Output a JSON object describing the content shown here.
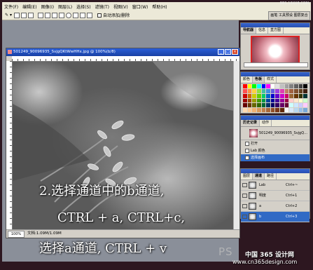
{
  "app": {
    "menu": [
      "文件(F)",
      "编辑(E)",
      "图像(I)",
      "图层(L)",
      "选择(S)",
      "滤镜(T)",
      "视图(V)",
      "窗口(W)",
      "帮助(H)"
    ],
    "brand": "BBS.16XX8.COM"
  },
  "options": {
    "auto_add_delete": "自动添加/删除",
    "palette_well": "画笔 工具预设 图层复合"
  },
  "document": {
    "title": "501249_90096935_SvjgQKtWwHHx.jpg @ 100%(b/8)",
    "zoom": "100%",
    "info": "文档:1.09M/1.09M"
  },
  "caption": {
    "line1": "2.选择通道中的b通道,",
    "line2": "CTRL + a, CTRL+c,",
    "line3": "选择a通道, CTRL + v"
  },
  "panels": {
    "navigator_tabs": [
      "导航器",
      "信息",
      "直方图"
    ],
    "color_tabs": [
      "颜色",
      "色板",
      "样式"
    ],
    "history_tabs": [
      "历史记录",
      "动作"
    ],
    "history_snapshot": "501249_90096935_SvjgQ...",
    "history_items": [
      "打开",
      "Lab 颜色",
      "选择画布"
    ],
    "channels_tabs": [
      "图层",
      "通道",
      "路径"
    ],
    "channels": [
      {
        "name": "Lab",
        "key": "Ctrl+~"
      },
      {
        "name": "明度",
        "key": "Ctrl+1"
      },
      {
        "name": "a",
        "key": "Ctrl+2"
      },
      {
        "name": "b",
        "key": "Ctrl+3"
      }
    ]
  },
  "swatch_colors": [
    "#ff0000",
    "#ffff00",
    "#00ff00",
    "#00ffff",
    "#0000ff",
    "#ff00ff",
    "#ffffff",
    "#e0e0e0",
    "#c0c0c0",
    "#a0a0a0",
    "#808080",
    "#606060",
    "#404040",
    "#000000",
    "#ff5050",
    "#ff9040",
    "#ffd040",
    "#90e040",
    "#40c0a0",
    "#4090e0",
    "#6060e0",
    "#a040e0",
    "#e040b0",
    "#c08060",
    "#a06040",
    "#805030",
    "#604020",
    "#402010",
    "#cc0000",
    "#cc6600",
    "#cccc00",
    "#66cc00",
    "#00cc66",
    "#0066cc",
    "#0000cc",
    "#6600cc",
    "#cc00cc",
    "#cc0066",
    "#996633",
    "#663300",
    "#333300",
    "#003333",
    "#990000",
    "#994400",
    "#999900",
    "#449900",
    "#009944",
    "#004499",
    "#000099",
    "#440099",
    "#990099",
    "#990044",
    "#ffcccc",
    "#ffe6cc",
    "#ffffcc",
    "#ccffcc",
    "#660000",
    "#663300",
    "#666600",
    "#336600",
    "#006633",
    "#003366",
    "#000066",
    "#330066",
    "#660066",
    "#660033",
    "#ccffff",
    "#cce6ff",
    "#ccccff",
    "#ffccff",
    "#ffd8b0",
    "#ffc890",
    "#f0b070",
    "#d89858",
    "#c08048",
    "#a86838",
    "#905028",
    "#783818",
    "#602808",
    "#f8f8f8",
    "#d8e8f8",
    "#b8d8f0",
    "#98c0e8",
    "#78a8d8"
  ],
  "watermark": {
    "logo": "PS",
    "site_cn": "中国 365 设计网",
    "url": "www.cn365design.com"
  }
}
